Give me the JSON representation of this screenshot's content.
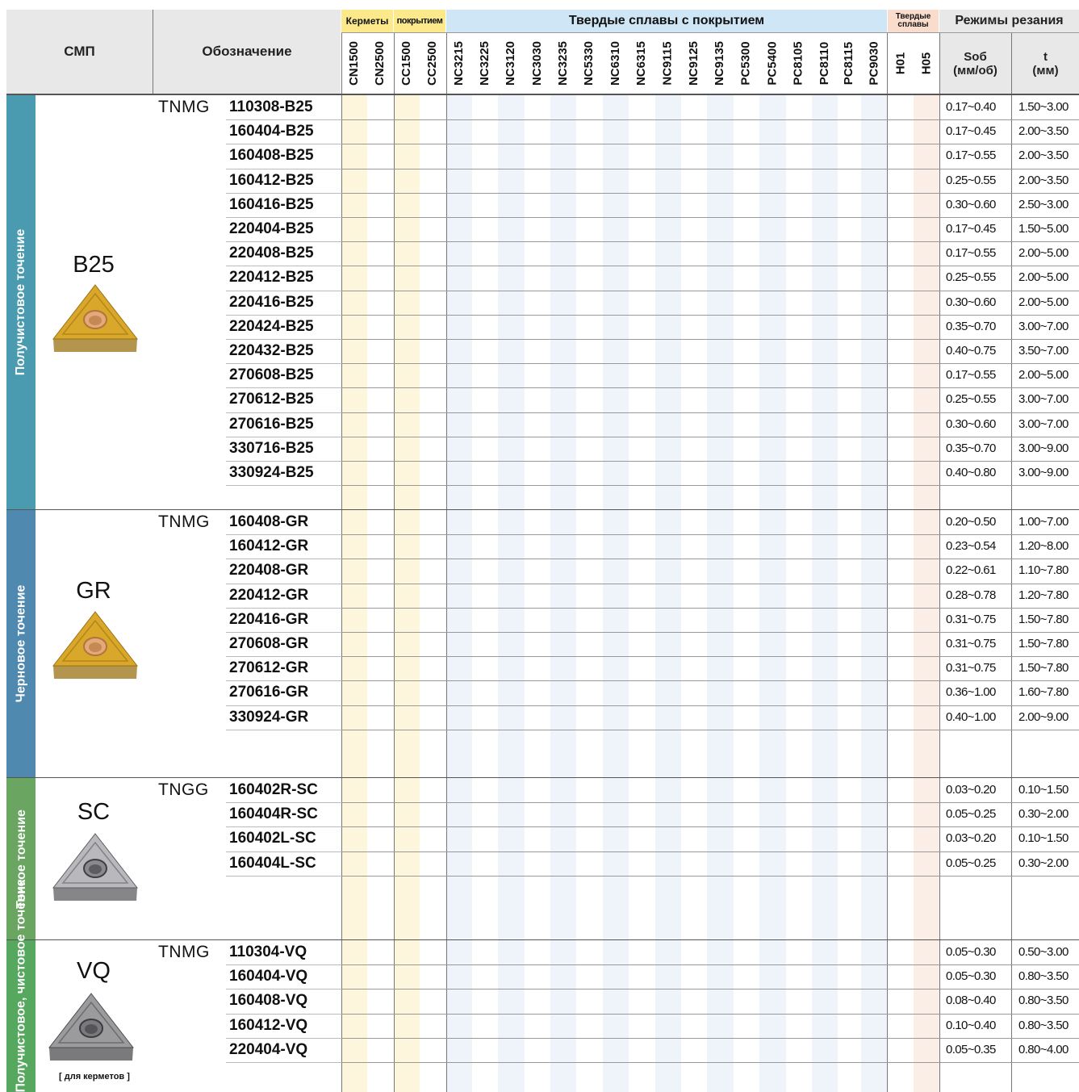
{
  "header": {
    "smp": "СМП",
    "designation": "Обозначение",
    "cermets": "Керметы",
    "coated_short": "покрытием",
    "coated_carbides": "Твердые сплавы с покрытием",
    "carbides": "Твердые сплавы",
    "cutting_modes": "Режимы резания",
    "feed": "Sоб",
    "feed_unit": "(мм/об)",
    "depth": "t",
    "depth_unit": "(мм)"
  },
  "grades": [
    "CN1500",
    "CN2500",
    "CC1500",
    "CC2500",
    "NC3215",
    "NC3225",
    "NC3120",
    "NC3030",
    "NC3235",
    "NC5330",
    "NC6310",
    "NC6315",
    "NC9115",
    "NC9125",
    "NC9135",
    "PC5300",
    "PC5400",
    "PC8105",
    "PC8110",
    "PC8115",
    "PC9030",
    "H01",
    "H05"
  ],
  "colors": {
    "header_gray": "#e8e8e8",
    "cermet_band": "#fbe98a",
    "cermet_col": "#fdf6dc",
    "coated_band": "#cfe6f6",
    "coated_col": "#eef4fa",
    "carbide_band": "#f9dccb",
    "carbide_col": "#fbeee6",
    "sidebar_b25": "#4a9bb0",
    "sidebar_gr": "#4f89b0",
    "sidebar_sc": "#6aa562",
    "sidebar_vq": "#55a85e"
  },
  "groups": [
    {
      "side_label": "Получистовое точение",
      "shape": "B25",
      "prefix": "TNMG",
      "icon": "triangle-insert-gold-icon",
      "rows": [
        {
          "code": "110308-B25",
          "feed": "0.17~0.40",
          "depth": "1.50~3.00"
        },
        {
          "code": "160404-B25",
          "feed": "0.17~0.45",
          "depth": "2.00~3.50"
        },
        {
          "code": "160408-B25",
          "feed": "0.17~0.55",
          "depth": "2.00~3.50"
        },
        {
          "code": "160412-B25",
          "feed": "0.25~0.55",
          "depth": "2.00~3.50"
        },
        {
          "code": "160416-B25",
          "feed": "0.30~0.60",
          "depth": "2.50~3.00"
        },
        {
          "code": "220404-B25",
          "feed": "0.17~0.45",
          "depth": "1.50~5.00"
        },
        {
          "code": "220408-B25",
          "feed": "0.17~0.55",
          "depth": "2.00~5.00"
        },
        {
          "code": "220412-B25",
          "feed": "0.25~0.55",
          "depth": "2.00~5.00"
        },
        {
          "code": "220416-B25",
          "feed": "0.30~0.60",
          "depth": "2.00~5.00"
        },
        {
          "code": "220424-B25",
          "feed": "0.35~0.70",
          "depth": "3.00~7.00"
        },
        {
          "code": "220432-B25",
          "feed": "0.40~0.75",
          "depth": "3.50~7.00"
        },
        {
          "code": "270608-B25",
          "feed": "0.17~0.55",
          "depth": "2.00~5.00"
        },
        {
          "code": "270612-B25",
          "feed": "0.25~0.55",
          "depth": "3.00~7.00"
        },
        {
          "code": "270616-B25",
          "feed": "0.30~0.60",
          "depth": "3.00~7.00"
        },
        {
          "code": "330716-B25",
          "feed": "0.35~0.70",
          "depth": "3.00~9.00"
        },
        {
          "code": "330924-B25",
          "feed": "0.40~0.80",
          "depth": "3.00~9.00"
        }
      ]
    },
    {
      "side_label": "Черновое точение",
      "shape": "GR",
      "prefix": "TNMG",
      "icon": "triangle-insert-gold-icon",
      "rows": [
        {
          "code": "160408-GR",
          "feed": "0.20~0.50",
          "depth": "1.00~7.00"
        },
        {
          "code": "160412-GR",
          "feed": "0.23~0.54",
          "depth": "1.20~8.00"
        },
        {
          "code": "220408-GR",
          "feed": "0.22~0.61",
          "depth": "1.10~7.80"
        },
        {
          "code": "220412-GR",
          "feed": "0.28~0.78",
          "depth": "1.20~7.80"
        },
        {
          "code": "220416-GR",
          "feed": "0.31~0.75",
          "depth": "1.50~7.80"
        },
        {
          "code": "270608-GR",
          "feed": "0.31~0.75",
          "depth": "1.50~7.80"
        },
        {
          "code": "270612-GR",
          "feed": "0.31~0.75",
          "depth": "1.50~7.80"
        },
        {
          "code": "270616-GR",
          "feed": "0.36~1.00",
          "depth": "1.60~7.80"
        },
        {
          "code": "330924-GR",
          "feed": "0.40~1.00",
          "depth": "2.00~9.00"
        }
      ]
    },
    {
      "side_label": "Тонкое точение",
      "shape": "SC",
      "prefix": "TNGG",
      "icon": "triangle-insert-silver-icon",
      "rows": [
        {
          "code": "160402R-SC",
          "feed": "0.03~0.20",
          "depth": "0.10~1.50"
        },
        {
          "code": "160404R-SC",
          "feed": "0.05~0.25",
          "depth": "0.30~2.00"
        },
        {
          "code": "160402L-SC",
          "feed": "0.03~0.20",
          "depth": "0.10~1.50"
        },
        {
          "code": "160404L-SC",
          "feed": "0.05~0.25",
          "depth": "0.30~2.00"
        }
      ]
    },
    {
      "side_label": "Получистовое, чистовое точение",
      "shape": "VQ",
      "prefix": "TNMG",
      "icon": "triangle-insert-gray-icon",
      "note": "[ для керметов ]",
      "rows": [
        {
          "code": "110304-VQ",
          "feed": "0.05~0.30",
          "depth": "0.50~3.00"
        },
        {
          "code": "160404-VQ",
          "feed": "0.05~0.30",
          "depth": "0.80~3.50"
        },
        {
          "code": "160408-VQ",
          "feed": "0.08~0.40",
          "depth": "0.80~3.50"
        },
        {
          "code": "160412-VQ",
          "feed": "0.10~0.40",
          "depth": "0.80~3.50"
        },
        {
          "code": "220404-VQ",
          "feed": "0.05~0.35",
          "depth": "0.80~4.00"
        }
      ]
    }
  ]
}
